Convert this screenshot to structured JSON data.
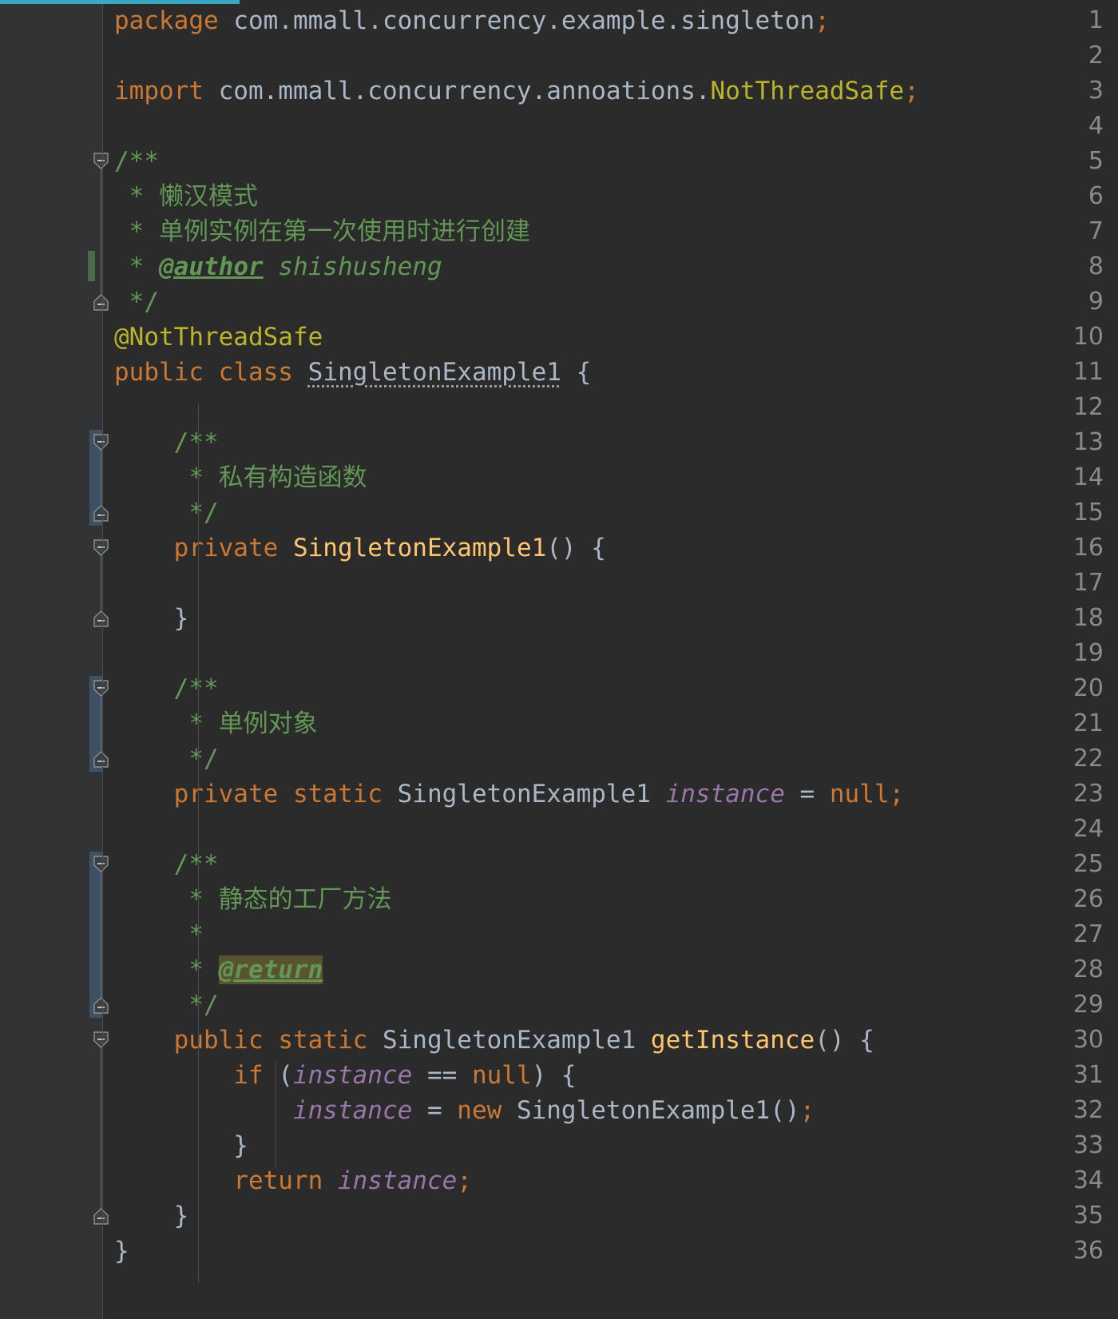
{
  "editor": {
    "theme": "darcula",
    "language": "java",
    "file_class": "SingletonExample1",
    "top_strip_color": "#3ba7c4",
    "background": "#2b2b2b",
    "gutter_background": "#313335",
    "line_number_color": "#888a8c",
    "first_line": 1,
    "last_line": 36,
    "colors": {
      "keyword": "#cc7832",
      "plain": "#a9b7c6",
      "annotation": "#bbb529",
      "comment": "#629755",
      "field": "#9876aa",
      "method": "#ffc66d",
      "caret_highlight": "#5a5330",
      "fold_band": "#3c5264",
      "change_stripe": "#4e6a4b"
    }
  },
  "line_numbers": [
    1,
    2,
    3,
    4,
    5,
    6,
    7,
    8,
    9,
    10,
    11,
    12,
    13,
    14,
    15,
    16,
    17,
    18,
    19,
    20,
    21,
    22,
    23,
    24,
    25,
    26,
    27,
    28,
    29,
    30,
    31,
    32,
    33,
    34,
    35,
    36
  ],
  "code_lines": [
    {
      "n": 1,
      "text": "package com.mmall.concurrency.example.singleton;"
    },
    {
      "n": 2,
      "text": ""
    },
    {
      "n": 3,
      "text": "import com.mmall.concurrency.annoations.NotThreadSafe;"
    },
    {
      "n": 4,
      "text": ""
    },
    {
      "n": 5,
      "text": "/**"
    },
    {
      "n": 6,
      "text": " * 懒汉模式"
    },
    {
      "n": 7,
      "text": " * 单例实例在第一次使用时进行创建"
    },
    {
      "n": 8,
      "text": " * @author shishusheng"
    },
    {
      "n": 9,
      "text": " */"
    },
    {
      "n": 10,
      "text": "@NotThreadSafe"
    },
    {
      "n": 11,
      "text": "public class SingletonExample1 {"
    },
    {
      "n": 12,
      "text": ""
    },
    {
      "n": 13,
      "text": "    /**"
    },
    {
      "n": 14,
      "text": "     * 私有构造函数"
    },
    {
      "n": 15,
      "text": "     */"
    },
    {
      "n": 16,
      "text": "    private SingletonExample1() {"
    },
    {
      "n": 17,
      "text": ""
    },
    {
      "n": 18,
      "text": "    }"
    },
    {
      "n": 19,
      "text": ""
    },
    {
      "n": 20,
      "text": "    /**"
    },
    {
      "n": 21,
      "text": "     * 单例对象"
    },
    {
      "n": 22,
      "text": "     */"
    },
    {
      "n": 23,
      "text": "    private static SingletonExample1 instance = null;"
    },
    {
      "n": 24,
      "text": ""
    },
    {
      "n": 25,
      "text": "    /**"
    },
    {
      "n": 26,
      "text": "     * 静态的工厂方法"
    },
    {
      "n": 27,
      "text": "     *"
    },
    {
      "n": 28,
      "text": "     * @return"
    },
    {
      "n": 29,
      "text": "     */"
    },
    {
      "n": 30,
      "text": "    public static SingletonExample1 getInstance() {"
    },
    {
      "n": 31,
      "text": "        if (instance == null) {"
    },
    {
      "n": 32,
      "text": "            instance = new SingletonExample1();"
    },
    {
      "n": 33,
      "text": "        }"
    },
    {
      "n": 34,
      "text": "        return instance;"
    },
    {
      "n": 35,
      "text": "    }"
    },
    {
      "n": 36,
      "text": "}"
    }
  ],
  "tokens": {
    "l1": {
      "kw": "package",
      "rest": " com.mmall.concurrency.example.singleton",
      "semi": ";"
    },
    "l3": {
      "kw": "import",
      "pkg": " com.mmall.concurrency.annoations.",
      "anno": "NotThreadSafe",
      "semi": ";"
    },
    "l5": "/**",
    "l6": " * 懒汉模式",
    "l7": " * 单例实例在第一次使用时进行创建",
    "l8": {
      "star": " * ",
      "tag": "@author",
      "value": " shishusheng"
    },
    "l9": " */",
    "l10": "@NotThreadSafe",
    "l11": {
      "kw1": "public",
      "kw2": "class",
      "cls": "SingletonExample1",
      "brace": "{"
    },
    "l13": "/**",
    "l14": " * 私有构造函数",
    "l15": " */",
    "l16": {
      "kw": "private",
      "ctor": "SingletonExample1",
      "parens": "()",
      "brace": "{"
    },
    "l18": "}",
    "l20": "/**",
    "l21": " * 单例对象",
    "l22": " */",
    "l23": {
      "kw1": "private",
      "kw2": "static",
      "type": "SingletonExample1",
      "field": "instance",
      "eq": "=",
      "val": "null",
      "semi": ";"
    },
    "l25": "/**",
    "l26": " * 静态的工厂方法",
    "l27": " *",
    "l28": {
      "star": " * ",
      "tag": "@return"
    },
    "l29": " */",
    "l30": {
      "kw1": "public",
      "kw2": "static",
      "type": "SingletonExample1",
      "method": "getInstance",
      "parens": "()",
      "brace": "{"
    },
    "l31": {
      "kw": "if",
      "open": "(",
      "field": "instance",
      "op": "==",
      "val": "null",
      "close": ")",
      "brace": "{"
    },
    "l32": {
      "field": "instance",
      "eq": "=",
      "kw": "new",
      "type": "SingletonExample1",
      "parens": "()",
      "semi": ";"
    },
    "l33": "}",
    "l34": {
      "kw": "return",
      "field": "instance",
      "semi": ";"
    },
    "l35": "}",
    "l36": "}"
  },
  "fold_markers": [
    {
      "line": 5,
      "state": "expanded",
      "icon": "fold-minus-icon"
    },
    {
      "line": 9,
      "state": "region-end",
      "icon": "fold-end-icon"
    },
    {
      "line": 13,
      "state": "expanded",
      "icon": "fold-minus-icon"
    },
    {
      "line": 15,
      "state": "region-end",
      "icon": "fold-end-icon"
    },
    {
      "line": 16,
      "state": "expanded",
      "icon": "fold-minus-icon"
    },
    {
      "line": 18,
      "state": "region-end",
      "icon": "fold-end-icon"
    },
    {
      "line": 20,
      "state": "expanded",
      "icon": "fold-minus-icon"
    },
    {
      "line": 22,
      "state": "region-end",
      "icon": "fold-end-icon"
    },
    {
      "line": 25,
      "state": "expanded",
      "icon": "fold-minus-icon"
    },
    {
      "line": 29,
      "state": "region-end",
      "icon": "fold-end-icon"
    },
    {
      "line": 30,
      "state": "expanded",
      "icon": "fold-minus-icon"
    },
    {
      "line": 35,
      "state": "region-end",
      "icon": "fold-end-icon"
    }
  ],
  "fold_bands": [
    {
      "from_line": 13,
      "to_line": 15
    },
    {
      "from_line": 20,
      "to_line": 22
    },
    {
      "from_line": 25,
      "to_line": 29
    }
  ],
  "change_stripes": [
    {
      "from_line": 8,
      "to_line": 8
    }
  ],
  "highlights": [
    {
      "line": 28,
      "token": "@return",
      "color": "#5a5330",
      "kind": "identifier-under-caret"
    }
  ],
  "inspections": [
    {
      "line": 11,
      "token": "SingletonExample1",
      "kind": "weak-warning-dotted-underline"
    }
  ]
}
